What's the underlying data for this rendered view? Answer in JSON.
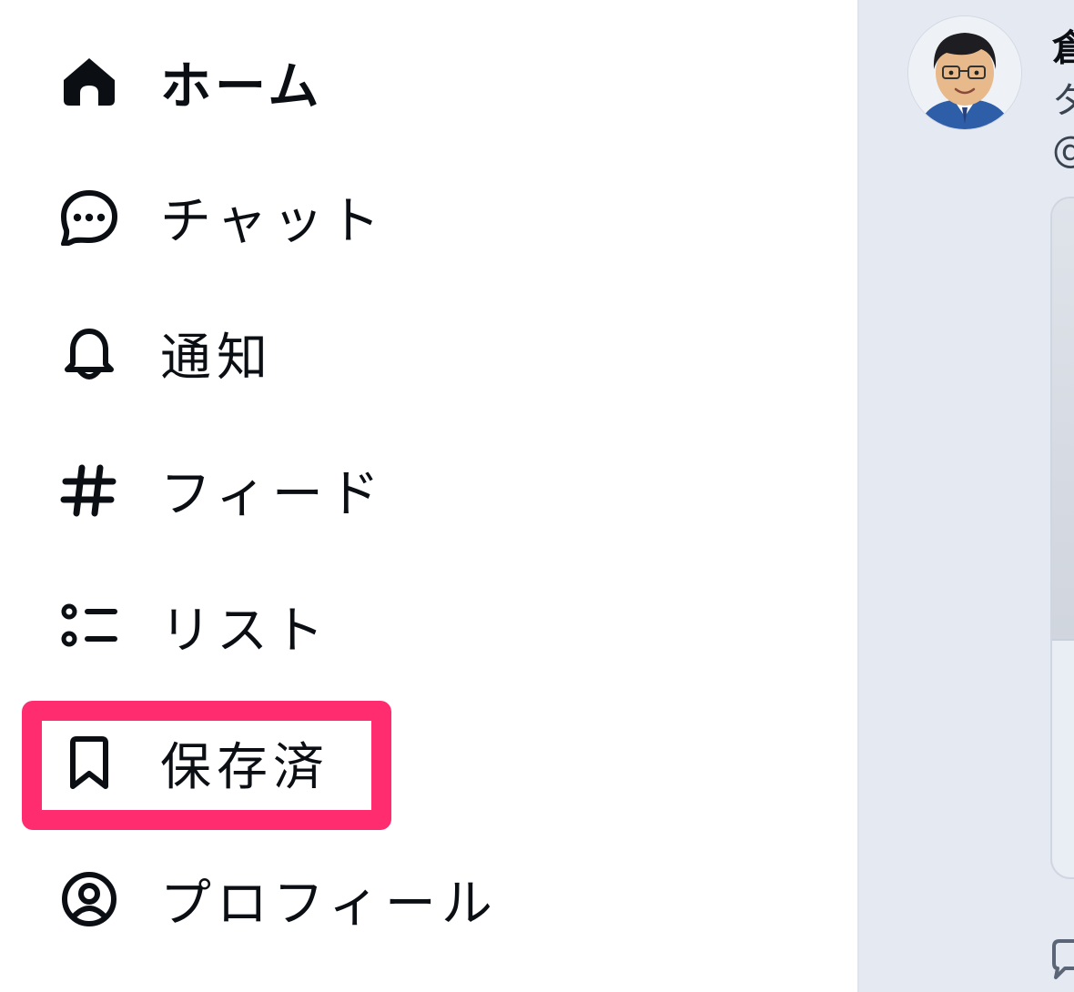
{
  "nav": {
    "home": "ホーム",
    "chat": "チャット",
    "notifications": "通知",
    "feeds": "フィード",
    "lists": "リスト",
    "saved": "保存済",
    "profile": "プロフィール"
  },
  "post": {
    "name": "倉",
    "text": "タ",
    "handle": "@"
  },
  "colors": {
    "highlight": "#ff2d6f",
    "feed_background": "#e4e9f2"
  },
  "icons": {
    "home": "home-icon",
    "chat": "chat-bubble-icon",
    "notifications": "bell-icon",
    "feeds": "hash-icon",
    "lists": "list-icon",
    "saved": "bookmark-icon",
    "profile": "user-circle-icon",
    "reply": "reply-icon"
  }
}
